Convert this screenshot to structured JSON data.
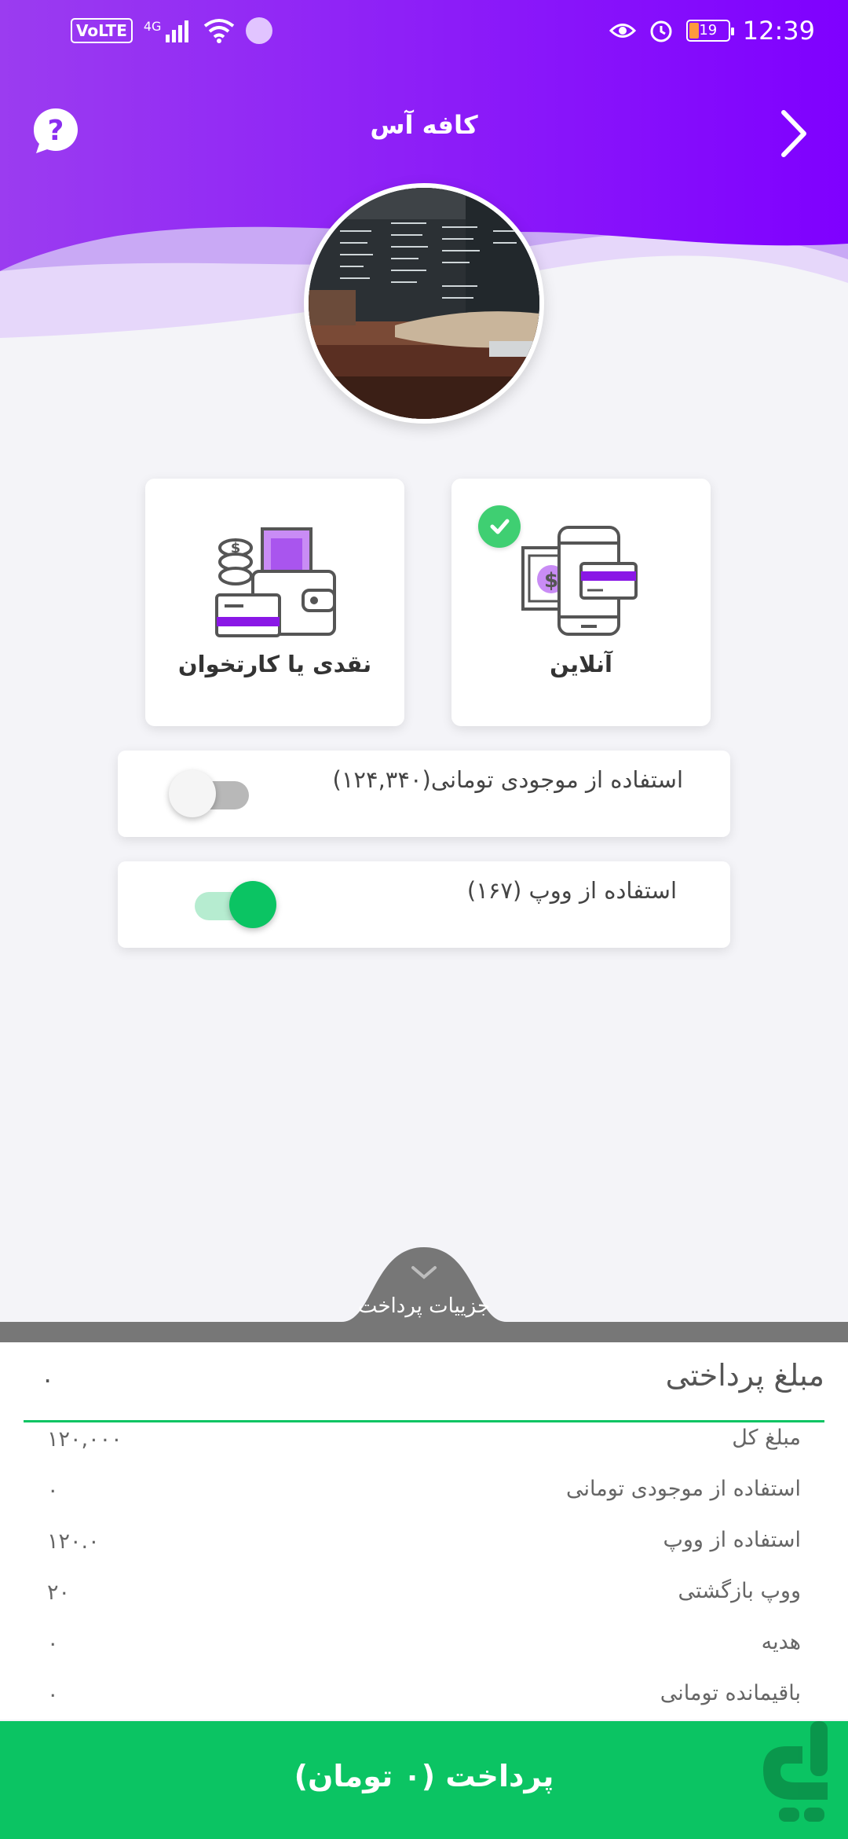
{
  "status_bar": {
    "volte": "VoLTE",
    "network": "4G",
    "battery": "19",
    "time": "12:39"
  },
  "header": {
    "title": "کافه آس",
    "help_icon": "question-bubble-icon",
    "back_icon": "chevron-right-icon"
  },
  "colors": {
    "header_gradient_start": "#9b3cf0",
    "header_gradient_end": "#7f00ff",
    "accent_green": "#0bc463",
    "icon_purple": "#8a17e6"
  },
  "payment_methods": [
    {
      "label": "آنلاین",
      "icon": "mobile-payment-icon",
      "selected": true
    },
    {
      "label": "نقدی یا کارتخوان",
      "icon": "cash-wallet-icon",
      "selected": false
    }
  ],
  "toggles": {
    "balance": {
      "label": "استفاده از موجودی تومانی(۱۲۴,۳۴۰)",
      "on": false
    },
    "woop": {
      "label": "استفاده از ووپ (۱۶۷)",
      "on": true
    }
  },
  "details": {
    "tab_label": "جزییات پرداخت",
    "total_label": "مبلغ پرداختی",
    "total_value": "۰",
    "rows": [
      {
        "label": "مبلغ کل",
        "value": "۱۲۰,۰۰۰"
      },
      {
        "label": "استفاده از موجودی تومانی",
        "value": "۰"
      },
      {
        "label": "استفاده از ووپ",
        "value": "۱۲۰.۰"
      },
      {
        "label": "ووپ بازگشتی",
        "value": "۲۰"
      },
      {
        "label": "هدیه",
        "value": "۰"
      },
      {
        "label": "باقیمانده تومانی",
        "value": "۰"
      }
    ]
  },
  "pay_button": {
    "label": "پرداخت (۰ تومان)"
  }
}
